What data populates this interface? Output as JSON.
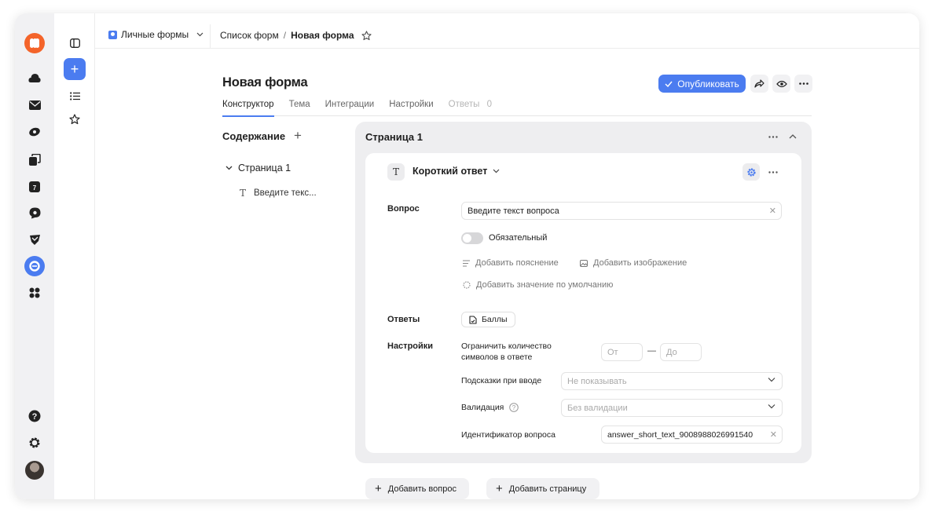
{
  "topbar": {
    "workspace": "Личные формы",
    "breadcrumb_list": "Список форм",
    "breadcrumb_sep": "/",
    "breadcrumb_current": "Новая форма"
  },
  "header": {
    "title": "Новая форма",
    "publish_label": "Опубликовать"
  },
  "tabs": [
    {
      "label": "Конструктор"
    },
    {
      "label": "Тема"
    },
    {
      "label": "Интеграции"
    },
    {
      "label": "Настройки"
    },
    {
      "label": "Ответы"
    }
  ],
  "answers_count": "0",
  "outline": {
    "title": "Содержание",
    "page_label": "Страница 1",
    "question_label": "Введите текс..."
  },
  "page": {
    "title": "Страница 1"
  },
  "question": {
    "type_label": "Короткий ответ",
    "question_label": "Вопрос",
    "question_value": "Введите текст вопроса",
    "required_label": "Обязательный",
    "add_description": "Добавить пояснение",
    "add_image": "Добавить изображение",
    "add_default": "Добавить значение по умолчанию",
    "answers_label": "Ответы",
    "score_chip": "Баллы",
    "settings_label": "Настройки",
    "limit_label_1": "Ограничить количество",
    "limit_label_2": "символов в ответе",
    "from_placeholder": "От",
    "dash": "—",
    "to_placeholder": "До",
    "hints_label": "Подсказки при вводе",
    "hints_value": "Не показывать",
    "validation_label": "Валидация",
    "validation_value": "Без валидации",
    "id_label": "Идентификатор вопроса",
    "id_value": "answer_short_text_9008988026991540"
  },
  "footer": {
    "add_question": "Добавить вопрос",
    "add_page": "Добавить страницу"
  },
  "colors": {
    "accent": "#4b7cf0",
    "brand": "#f4642a",
    "card_bg": "#eeeef0"
  }
}
